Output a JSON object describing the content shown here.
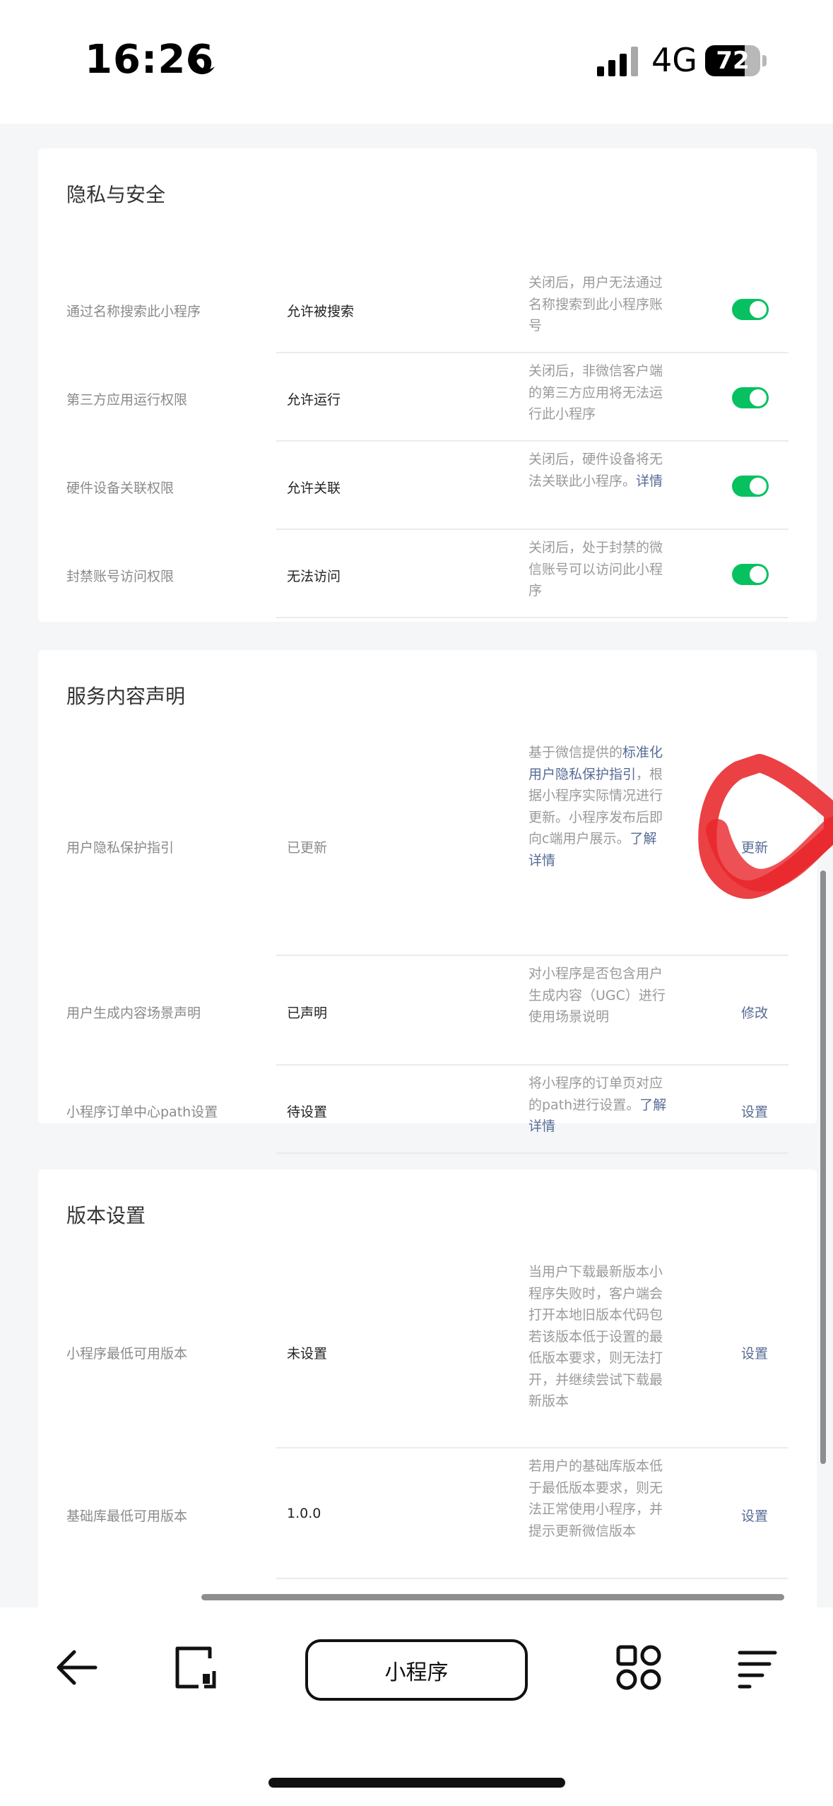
{
  "status_bar": {
    "time": "16:26",
    "network": "4G",
    "battery": "72",
    "battery_level": 0.72
  },
  "sections": [
    {
      "title": "隐私与安全",
      "rows": [
        {
          "label": "通过名称搜索此小程序",
          "value": "允许被搜索",
          "desc": [
            {
              "t": "关闭后，用户无法通过名称搜索到此小程序账号"
            }
          ],
          "control": "toggle",
          "on": true
        },
        {
          "label": "第三方应用运行权限",
          "value": "允许运行",
          "desc": [
            {
              "t": "关闭后，非微信客户端的第三方应用将无法运行此小程序"
            }
          ],
          "control": "toggle",
          "on": true
        },
        {
          "label": "硬件设备关联权限",
          "value": "允许关联",
          "desc": [
            {
              "t": "关闭后，硬件设备将无法关联此小程序。"
            },
            {
              "t": "详情",
              "link": true
            }
          ],
          "control": "toggle",
          "on": true
        },
        {
          "label": "封禁账号访问权限",
          "value": "无法访问",
          "desc": [
            {
              "t": "关闭后，处于封禁的微信账号可以访问此小程序"
            }
          ],
          "control": "toggle",
          "on": true
        }
      ]
    },
    {
      "title": "服务内容声明",
      "rows": [
        {
          "label": "用户隐私保护指引",
          "value": "已更新",
          "desc": [
            {
              "t": "基于微信提供的"
            },
            {
              "t": "标准化用户隐私保护指引",
              "link": true
            },
            {
              "t": "，根据小程序实际情况进行更新。小程序发布后即向c端用户展示。"
            },
            {
              "t": "了解详情",
              "link": true
            }
          ],
          "control": "action",
          "action": "更新"
        },
        {
          "label": "用户生成内容场景声明",
          "value": "已声明",
          "desc": [
            {
              "t": "对小程序是否包含用户生成内容（UGC）进行使用场景说明"
            }
          ],
          "control": "action",
          "action": "修改"
        },
        {
          "label": "小程序订单中心path设置",
          "value": "待设置",
          "desc": [
            {
              "t": "将小程序的订单页对应的path进行设置。"
            },
            {
              "t": "了解详情",
              "link": true
            }
          ],
          "control": "action",
          "action": "设置"
        }
      ]
    },
    {
      "title": "版本设置",
      "rows": [
        {
          "label": "小程序最低可用版本",
          "value": "未设置",
          "desc": [
            {
              "t": "当用户下载最新版本小程序失败时，客户端会打开本地旧版本代码包若该版本低于设置的最低版本要求，则无法打开，并继续尝试下载最新版本"
            }
          ],
          "control": "action",
          "action": "设置"
        },
        {
          "label": "基础库最低可用版本",
          "value": "1.0.0",
          "desc": [
            {
              "t": "若用户的基础库版本低于最低版本要求，则无法正常使用小程序，并提示更新微信版本"
            }
          ],
          "control": "action",
          "action": "设置"
        }
      ]
    }
  ],
  "bottom_nav": {
    "center_label": "小程序"
  }
}
